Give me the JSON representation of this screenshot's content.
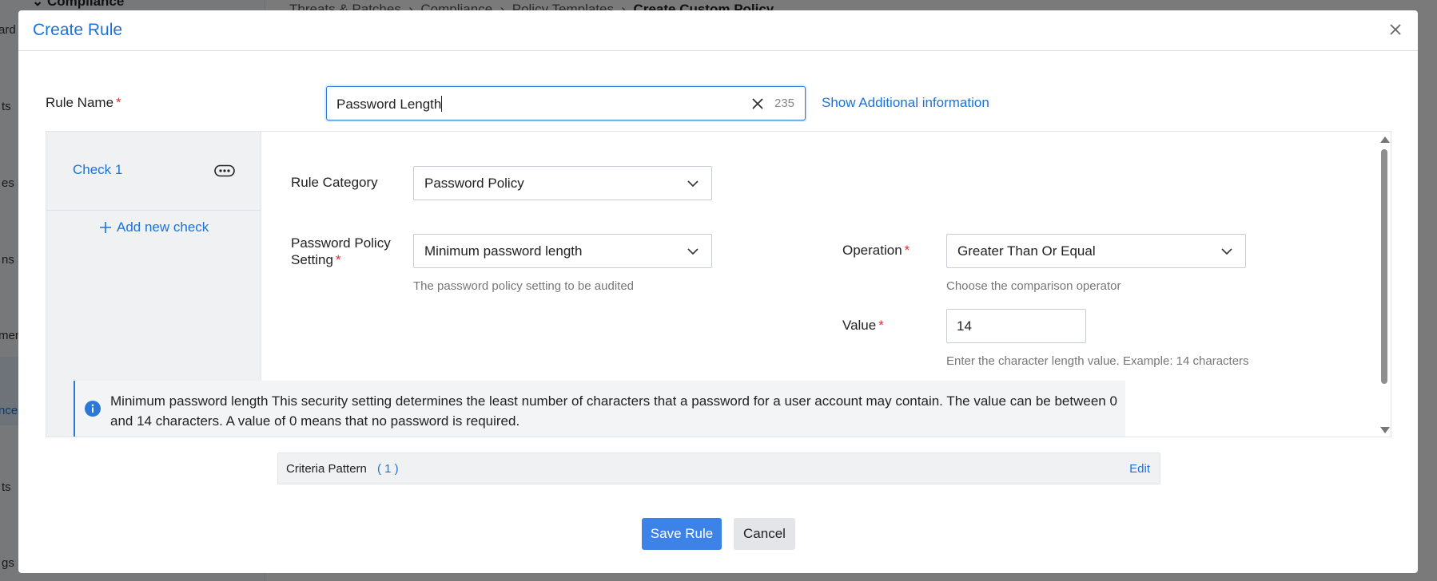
{
  "background": {
    "section_heading": "Compliance",
    "breadcrumb": [
      "Threats & Patches",
      "Compliance",
      "Policy Templates",
      "Create Custom Policy"
    ],
    "sidebar_fragments": [
      "ard",
      "ts",
      "es",
      "ns",
      "ment",
      "nce",
      "ts",
      "gs"
    ]
  },
  "modal": {
    "title": "Create Rule",
    "close_icon": "close-icon"
  },
  "rule_name": {
    "label": "Rule Name",
    "required_mark": "*",
    "value": "Password Length",
    "char_count": "235",
    "show_additional_link": "Show Additional information"
  },
  "checks": {
    "items": [
      {
        "label": "Check 1",
        "menu_icon": "more-options-icon"
      }
    ],
    "add_label": "Add new check"
  },
  "form": {
    "rule_category": {
      "label": "Rule Category",
      "value": "Password Policy"
    },
    "policy_setting": {
      "label_line1": "Password Policy",
      "label_line2": "Setting",
      "required_mark": "*",
      "value": "Minimum password length",
      "help": "The password policy setting to be audited"
    },
    "operation": {
      "label": "Operation",
      "required_mark": "*",
      "value": "Greater Than Or Equal",
      "help": "Choose the comparison operator"
    },
    "value": {
      "label": "Value",
      "required_mark": "*",
      "value": "14",
      "help": "Enter the character length value. Example: 14 characters"
    },
    "info": {
      "icon": "info-icon",
      "text": "Minimum password length This security setting determines the least number of characters that a password for a user account may contain. The value can be between 0 and 14 characters. A value of 0 means that no password is required."
    }
  },
  "criteria": {
    "label": "Criteria Pattern",
    "count": "( 1 )",
    "edit_label": "Edit"
  },
  "actions": {
    "save_label": "Save Rule",
    "cancel_label": "Cancel"
  },
  "colors": {
    "accent": "#1a73d9",
    "primary_button": "#3d82e6",
    "required": "#e03030"
  }
}
